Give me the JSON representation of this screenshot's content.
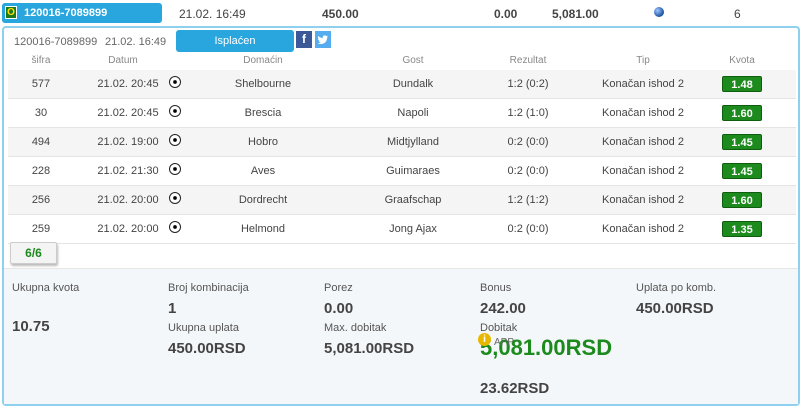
{
  "top": {
    "badge": "O",
    "ticket_id": "120016-7089899",
    "date": "21.02. 16:49",
    "stake": "450.00",
    "tax": "0.00",
    "payout": "5,081.00",
    "matches": "6"
  },
  "panel": {
    "ticket_id": "120016-7089899",
    "date": "21.02. 16:49",
    "status": "Isplaćen",
    "facebook": "f"
  },
  "columns": {
    "code": "šifra",
    "date": "Datum",
    "home": "Domaćin",
    "away": "Gost",
    "result": "Rezultat",
    "tip": "Tip",
    "odds": "Kvota"
  },
  "rows": [
    {
      "code": "577",
      "date": "21.02. 20:45",
      "home": "Shelbourne",
      "away": "Dundalk",
      "result": "1:2 (0:2)",
      "tip": "Konačan ishod 2",
      "odds": "1.48"
    },
    {
      "code": "30",
      "date": "21.02. 20:45",
      "home": "Brescia",
      "away": "Napoli",
      "result": "1:2 (1:0)",
      "tip": "Konačan ishod 2",
      "odds": "1.60"
    },
    {
      "code": "494",
      "date": "21.02. 19:00",
      "home": "Hobro",
      "away": "Midtjylland",
      "result": "0:2 (0:0)",
      "tip": "Konačan ishod 2",
      "odds": "1.45"
    },
    {
      "code": "228",
      "date": "21.02. 21:30",
      "home": "Aves",
      "away": "Guimaraes",
      "result": "0:2 (0:0)",
      "tip": "Konačan ishod 2",
      "odds": "1.45"
    },
    {
      "code": "256",
      "date": "21.02. 20:00",
      "home": "Dordrecht",
      "away": "Graafschap",
      "result": "1:2 (1:2)",
      "tip": "Konačan ishod 2",
      "odds": "1.60"
    },
    {
      "code": "259",
      "date": "21.02. 20:00",
      "home": "Helmond",
      "away": "Jong Ajax",
      "result": "0:2 (0:0)",
      "tip": "Konačan ishod 2",
      "odds": "1.35"
    }
  ],
  "count_tab": "6/6",
  "summary": {
    "total_odds_label": "Ukupna kvota",
    "total_odds": "10.75",
    "combinations_label": "Broj kombinacija",
    "combinations": "1",
    "total_stake_label": "Ukupna uplata",
    "total_stake": "450.00RSD",
    "tax_label": "Porez",
    "tax": "0.00",
    "max_win_label": "Max. dobitak",
    "max_win": "5,081.00RSD",
    "bonus_label": "Bonus",
    "bonus": "242.00",
    "win_label": "Dobitak",
    "win": "5,081.00RSD",
    "app_label": "APP",
    "app_value": "23.62RSD",
    "stake_per_comb_label": "Uplata po komb.",
    "stake_per_comb": "450.00RSD"
  },
  "colors": {
    "accent": "#29a6dd",
    "odds_green": "#1c8a1c",
    "panel_border": "#8fd0ee"
  }
}
